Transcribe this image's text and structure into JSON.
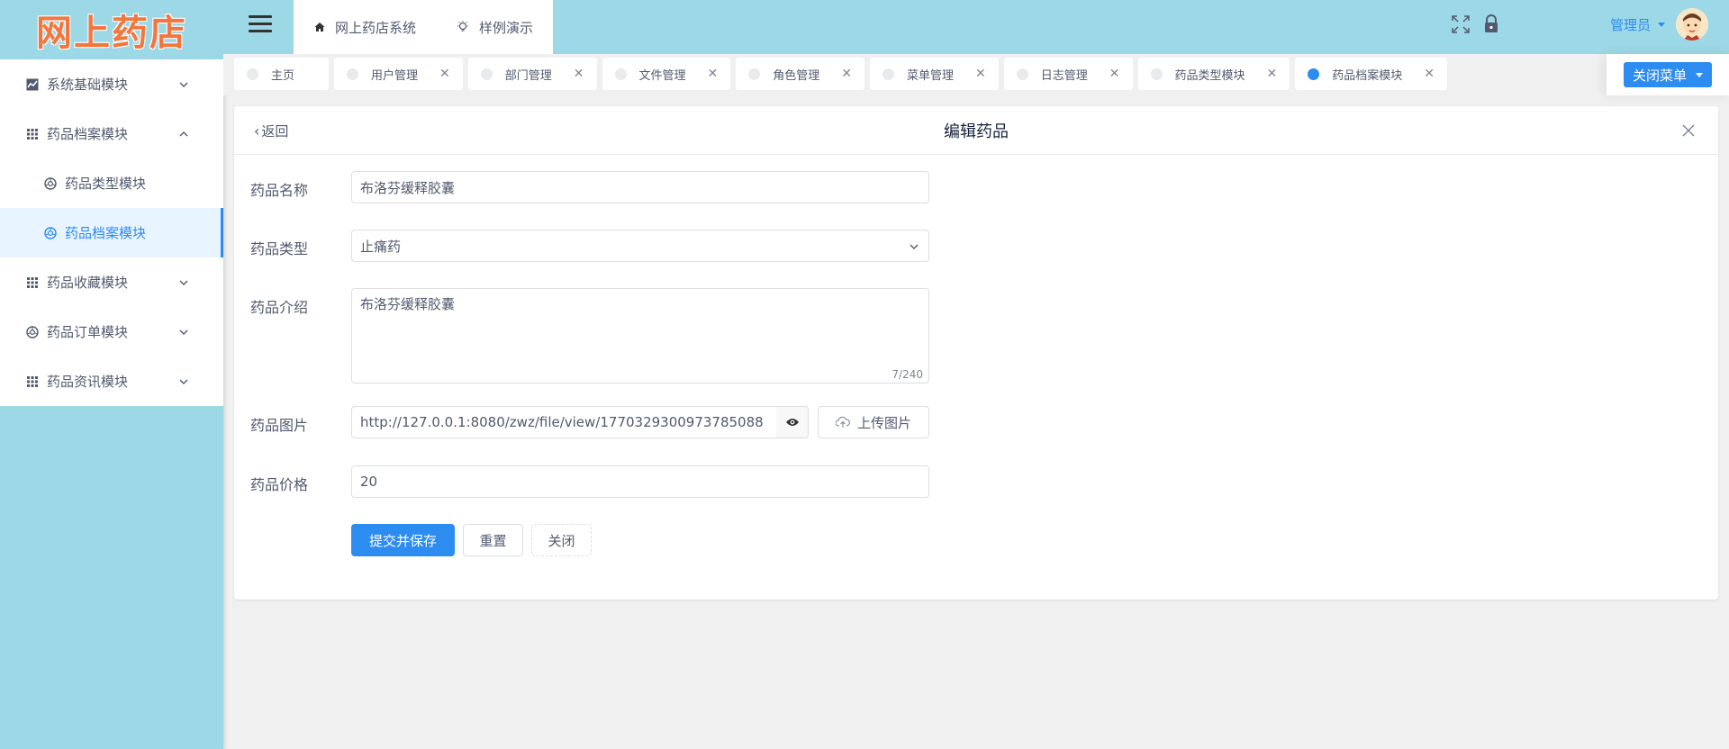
{
  "brand": {
    "logo_text": "网上药店",
    "logo_color": "#f2773f"
  },
  "sidebar": {
    "items": [
      {
        "label": "系统基础模块",
        "icon": "chart-icon",
        "expanded": false
      },
      {
        "label": "药品档案模块",
        "icon": "grid-icon",
        "expanded": true
      },
      {
        "label": "药品类型模块",
        "icon": "aperture-icon",
        "sub": true
      },
      {
        "label": "药品档案模块",
        "icon": "aperture-icon",
        "sub": true,
        "active": true
      },
      {
        "label": "药品收藏模块",
        "icon": "grid-icon",
        "expanded": false
      },
      {
        "label": "药品订单模块",
        "icon": "aperture-icon",
        "expanded": false
      },
      {
        "label": "药品资讯模块",
        "icon": "grid-icon",
        "expanded": false
      }
    ]
  },
  "header": {
    "top_tabs": [
      {
        "label": "网上药店系统",
        "icon": "home-icon"
      },
      {
        "label": "样例演示",
        "icon": "bulb-icon"
      }
    ],
    "user_name": "管理员"
  },
  "tagbar": {
    "tags": [
      {
        "label": "主页",
        "closable": false,
        "active": false
      },
      {
        "label": "用户管理",
        "closable": true,
        "active": false
      },
      {
        "label": "部门管理",
        "closable": true,
        "active": false
      },
      {
        "label": "文件管理",
        "closable": true,
        "active": false
      },
      {
        "label": "角色管理",
        "closable": true,
        "active": false
      },
      {
        "label": "菜单管理",
        "closable": true,
        "active": false
      },
      {
        "label": "日志管理",
        "closable": true,
        "active": false
      },
      {
        "label": "药品类型模块",
        "closable": true,
        "active": false
      },
      {
        "label": "药品档案模块",
        "closable": true,
        "active": true
      }
    ],
    "close_menu_label": "关闭菜单"
  },
  "card": {
    "back_label": "返回",
    "title": "编辑药品"
  },
  "form": {
    "name_label": "药品名称",
    "name_value": "布洛芬缓释胶囊",
    "type_label": "药品类型",
    "type_value": "止痛药",
    "intro_label": "药品介绍",
    "intro_value": "布洛芬缓释胶囊",
    "intro_count": "7/240",
    "image_label": "药品图片",
    "image_url": "http://127.0.0.1:8080/zwz/file/view/1770329300973785088",
    "upload_label": "上传图片",
    "price_label": "药品价格",
    "price_value": "20",
    "submit_label": "提交并保存",
    "reset_label": "重置",
    "close_label": "关闭"
  },
  "colors": {
    "accent": "#2d8cf0",
    "sidebar_bg": "#9dd8e6",
    "page_bg": "#f0f0f0"
  }
}
